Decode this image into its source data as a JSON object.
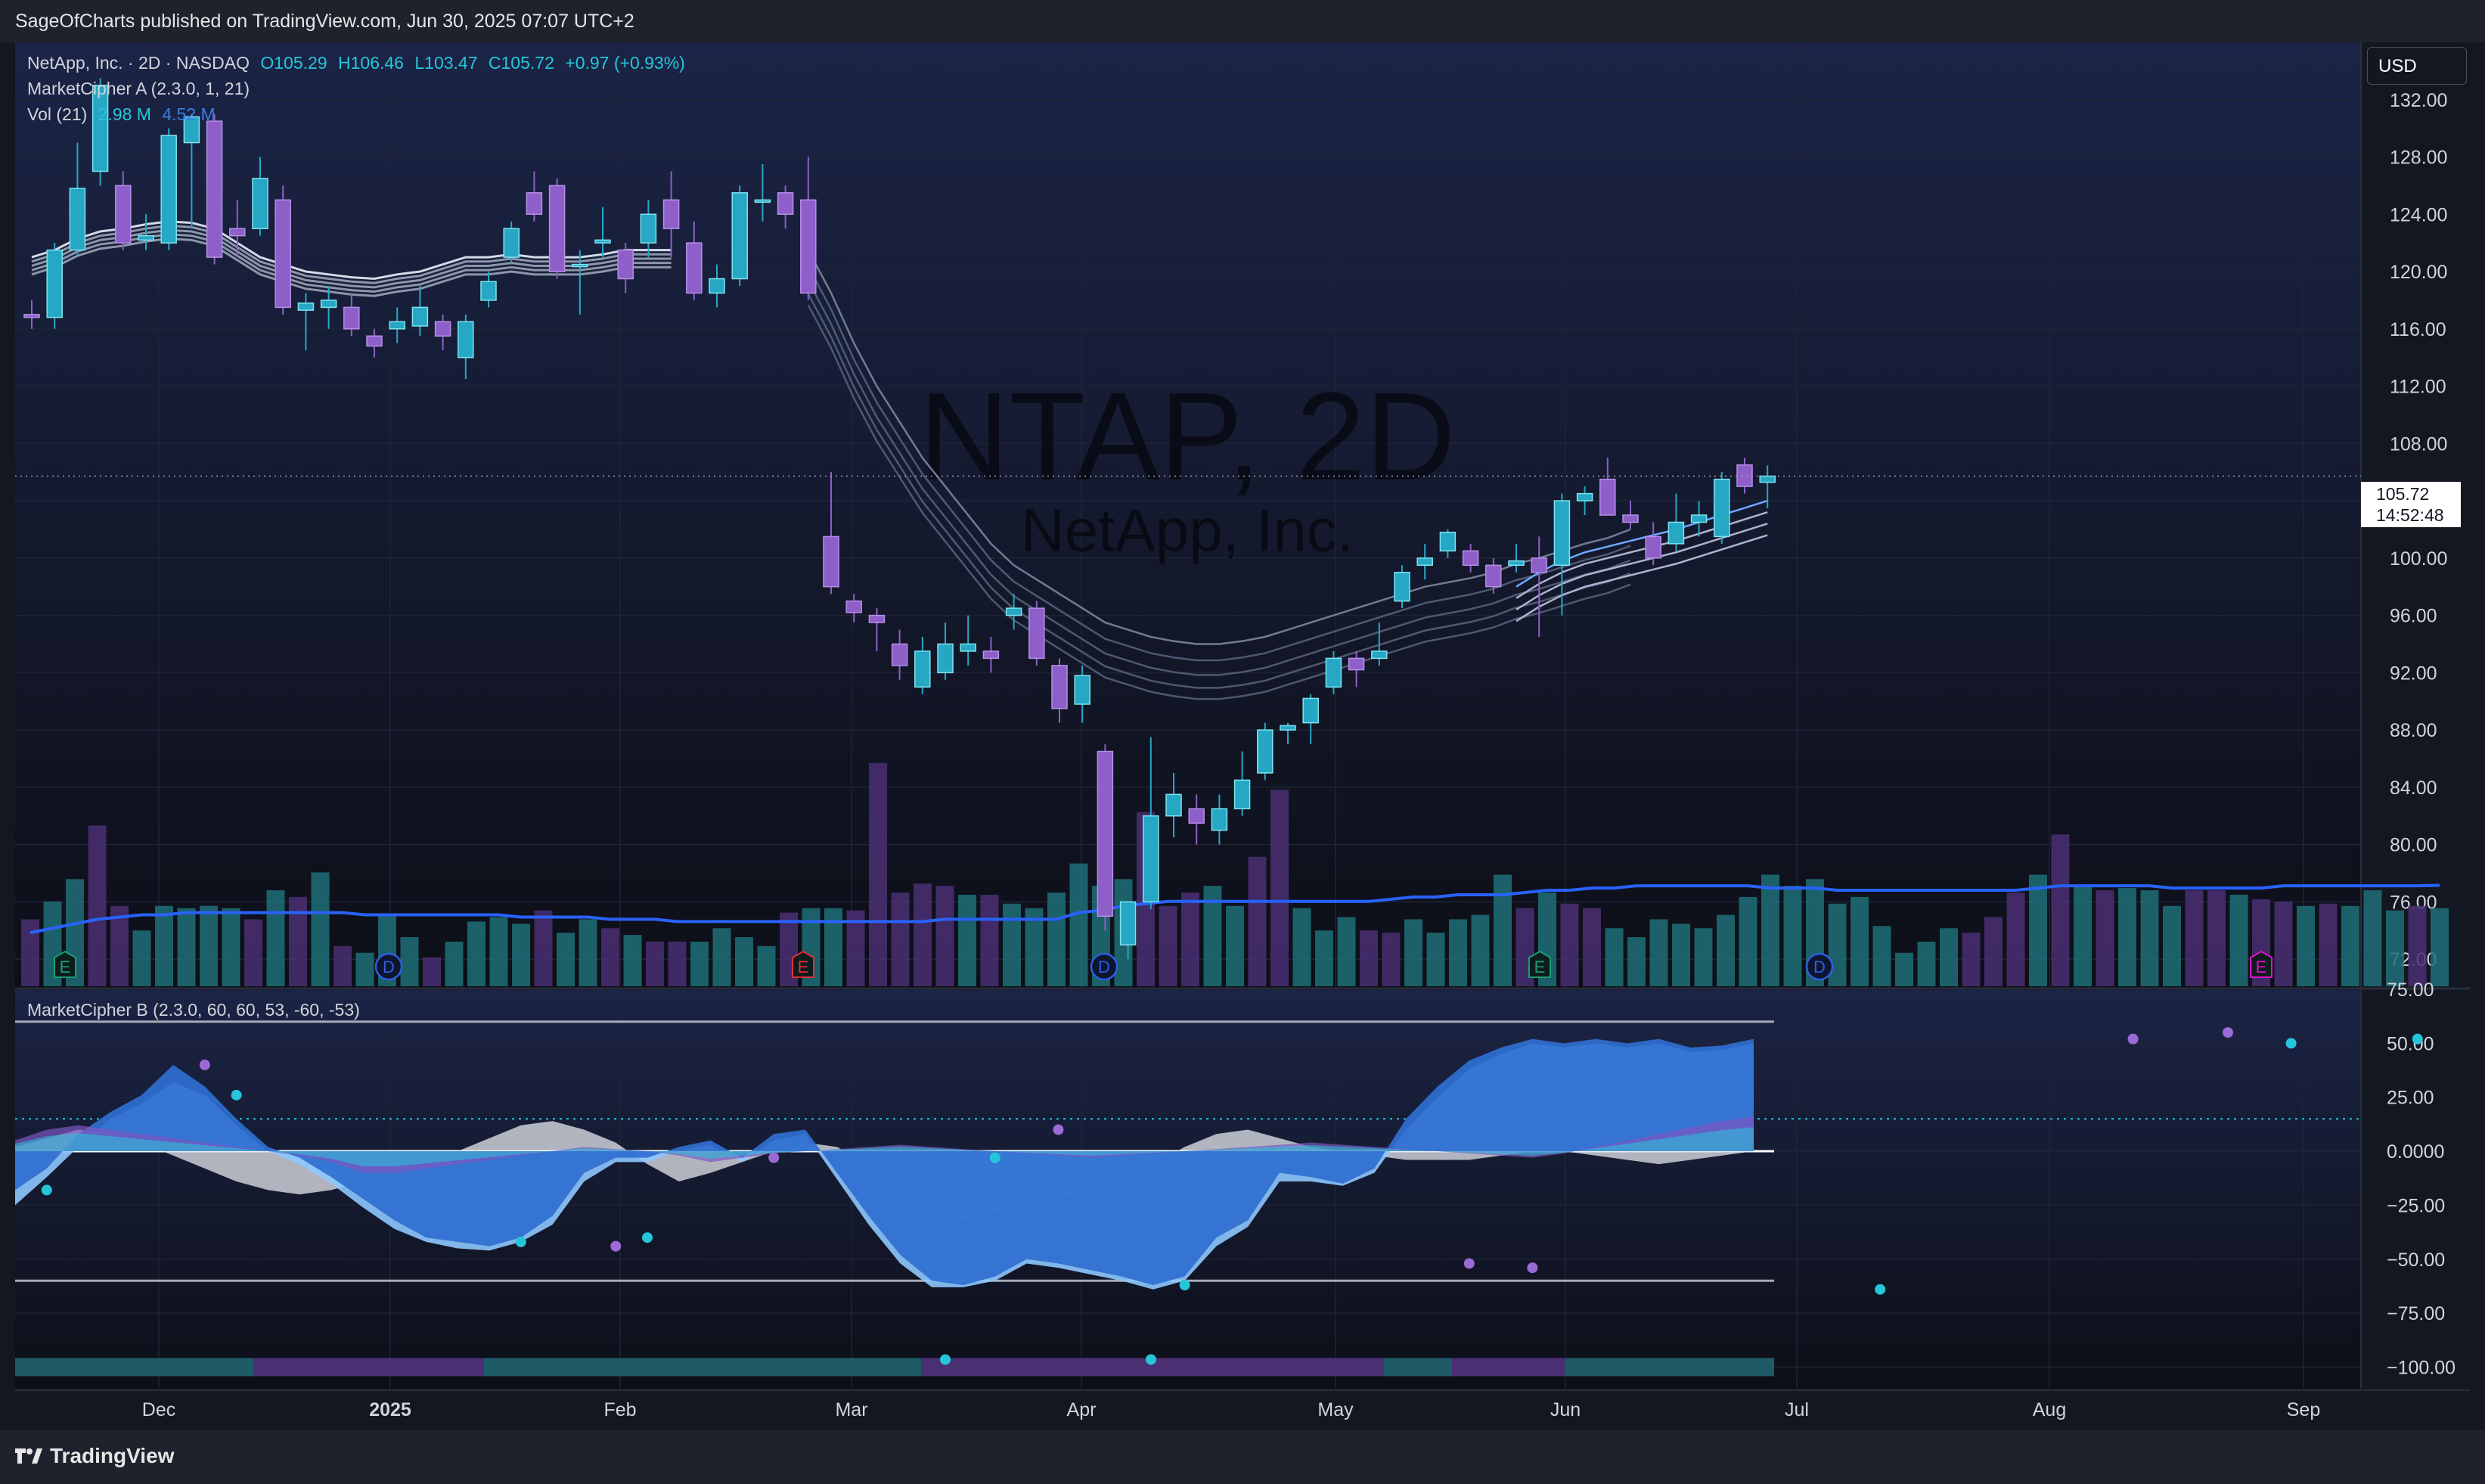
{
  "header": {
    "published_by": "SageOfCharts published on TradingView.com, Jun 30, 2025 07:07 UTC+2"
  },
  "legend": {
    "symbol": "NetApp, Inc. · 2D · NASDAQ",
    "open": "O105.29",
    "high": "H106.46",
    "low": "L103.47",
    "close": "C105.72",
    "change": "+0.97 (+0.93%)",
    "indicator_a": "MarketCipher A (2.3.0, 1, 21)",
    "vol_label": "Vol (21)",
    "vol_value": "2.98 M",
    "vol_ma": "4.52 M",
    "indicator_b": "MarketCipher B (2.3.0, 60, 60, 53, -60, -53)"
  },
  "currency": "USD",
  "last_price": {
    "price": "105.72",
    "countdown": "14:52:48"
  },
  "watermark": {
    "ticker": "NTAP, 2D",
    "company": "NetApp, Inc."
  },
  "footer": {
    "brand": "TradingView"
  },
  "colors": {
    "up": "#26a7c4",
    "down": "#8e5fc9",
    "background": "#131722",
    "ma_line": "#2962ff",
    "wave_blue": "#2f6fd0",
    "wave_light": "#8ec8ff"
  },
  "chart_data": [
    {
      "type": "candlestick",
      "title": "NetApp, Inc. · 2D · NASDAQ",
      "ylim": [
        70,
        136
      ],
      "y_ticks": [
        "132.00",
        "128.00",
        "124.00",
        "120.00",
        "116.00",
        "112.00",
        "108.00",
        "104.00",
        "100.00",
        "96.00",
        "92.00",
        "88.00",
        "84.00",
        "80.00",
        "76.00",
        "72.00"
      ],
      "x_ticks": [
        "Dec",
        "2025",
        "Feb",
        "Mar",
        "Apr",
        "May",
        "Jun",
        "Jul",
        "Aug",
        "Sep"
      ],
      "candles": [
        {
          "o": 117.0,
          "h": 118.0,
          "l": 116.0,
          "c": 116.8
        },
        {
          "o": 116.8,
          "h": 122.0,
          "l": 116.0,
          "c": 121.5
        },
        {
          "o": 121.5,
          "h": 129.0,
          "l": 121.0,
          "c": 125.8
        },
        {
          "o": 127.0,
          "h": 133.5,
          "l": 126.0,
          "c": 133.0
        },
        {
          "o": 126.0,
          "h": 127.0,
          "l": 121.5,
          "c": 122.0
        },
        {
          "o": 122.2,
          "h": 124.0,
          "l": 121.5,
          "c": 122.5
        },
        {
          "o": 122.0,
          "h": 130.0,
          "l": 121.5,
          "c": 129.5
        },
        {
          "o": 129.0,
          "h": 131.0,
          "l": 123.0,
          "c": 130.8
        },
        {
          "o": 130.5,
          "h": 131.0,
          "l": 120.5,
          "c": 121.0
        },
        {
          "o": 123.0,
          "h": 125.0,
          "l": 121.0,
          "c": 122.5
        },
        {
          "o": 123.0,
          "h": 128.0,
          "l": 122.5,
          "c": 126.5
        },
        {
          "o": 125.0,
          "h": 126.0,
          "l": 117.0,
          "c": 117.5
        },
        {
          "o": 117.3,
          "h": 118.5,
          "l": 114.5,
          "c": 117.8
        },
        {
          "o": 117.5,
          "h": 119.0,
          "l": 116.0,
          "c": 118.0
        },
        {
          "o": 117.5,
          "h": 118.5,
          "l": 115.5,
          "c": 116.0
        },
        {
          "o": 115.5,
          "h": 116.0,
          "l": 114.0,
          "c": 114.8
        },
        {
          "o": 116.0,
          "h": 117.5,
          "l": 115.0,
          "c": 116.5
        },
        {
          "o": 116.2,
          "h": 119.0,
          "l": 115.5,
          "c": 117.5
        },
        {
          "o": 116.5,
          "h": 117.0,
          "l": 114.5,
          "c": 115.5
        },
        {
          "o": 114.0,
          "h": 117.0,
          "l": 112.5,
          "c": 116.5
        },
        {
          "o": 118.0,
          "h": 120.0,
          "l": 117.5,
          "c": 119.3
        },
        {
          "o": 121.0,
          "h": 123.5,
          "l": 120.5,
          "c": 123.0
        },
        {
          "o": 125.5,
          "h": 127.0,
          "l": 123.5,
          "c": 124.0
        },
        {
          "o": 126.0,
          "h": 126.5,
          "l": 119.5,
          "c": 120.0
        },
        {
          "o": 120.5,
          "h": 121.5,
          "l": 117.0,
          "c": 120.5
        },
        {
          "o": 122.0,
          "h": 124.5,
          "l": 121.0,
          "c": 122.2
        },
        {
          "o": 121.5,
          "h": 122.0,
          "l": 118.5,
          "c": 119.5
        },
        {
          "o": 122.0,
          "h": 125.0,
          "l": 121.0,
          "c": 124.0
        },
        {
          "o": 125.0,
          "h": 127.0,
          "l": 121.0,
          "c": 123.0
        },
        {
          "o": 122.0,
          "h": 123.5,
          "l": 118.0,
          "c": 118.5
        },
        {
          "o": 118.5,
          "h": 120.5,
          "l": 117.5,
          "c": 119.5
        },
        {
          "o": 119.5,
          "h": 126.0,
          "l": 119.0,
          "c": 125.5
        },
        {
          "o": 125.0,
          "h": 127.5,
          "l": 123.5,
          "c": 125.0
        },
        {
          "o": 125.5,
          "h": 126.0,
          "l": 123.0,
          "c": 124.0
        },
        {
          "o": 125.0,
          "h": 128.0,
          "l": 118.0,
          "c": 118.5
        },
        {
          "o": 101.5,
          "h": 106.0,
          "l": 97.5,
          "c": 98.0
        },
        {
          "o": 97.0,
          "h": 97.5,
          "l": 95.5,
          "c": 96.2
        },
        {
          "o": 96.0,
          "h": 96.5,
          "l": 93.5,
          "c": 95.5
        },
        {
          "o": 94.0,
          "h": 95.0,
          "l": 91.5,
          "c": 92.5
        },
        {
          "o": 91.0,
          "h": 94.5,
          "l": 90.5,
          "c": 93.5
        },
        {
          "o": 92.0,
          "h": 95.5,
          "l": 91.5,
          "c": 94.0
        },
        {
          "o": 93.5,
          "h": 96.0,
          "l": 92.5,
          "c": 94.0
        },
        {
          "o": 93.5,
          "h": 94.5,
          "l": 92.0,
          "c": 93.0
        },
        {
          "o": 96.0,
          "h": 97.5,
          "l": 95.0,
          "c": 96.5
        },
        {
          "o": 96.5,
          "h": 97.0,
          "l": 92.5,
          "c": 93.0
        },
        {
          "o": 92.5,
          "h": 93.0,
          "l": 88.5,
          "c": 89.5
        },
        {
          "o": 89.8,
          "h": 92.5,
          "l": 88.5,
          "c": 91.8
        },
        {
          "o": 86.5,
          "h": 87.0,
          "l": 74.0,
          "c": 75.0
        },
        {
          "o": 73.0,
          "h": 76.0,
          "l": 72.0,
          "c": 76.0
        },
        {
          "o": 76.0,
          "h": 87.5,
          "l": 75.5,
          "c": 82.0
        },
        {
          "o": 82.0,
          "h": 85.0,
          "l": 80.5,
          "c": 83.5
        },
        {
          "o": 82.5,
          "h": 83.5,
          "l": 80.0,
          "c": 81.5
        },
        {
          "o": 81.0,
          "h": 83.5,
          "l": 80.0,
          "c": 82.5
        },
        {
          "o": 82.5,
          "h": 86.5,
          "l": 82.0,
          "c": 84.5
        },
        {
          "o": 85.0,
          "h": 88.5,
          "l": 84.5,
          "c": 88.0
        },
        {
          "o": 88.0,
          "h": 88.5,
          "l": 87.0,
          "c": 88.3
        },
        {
          "o": 88.5,
          "h": 90.5,
          "l": 87.0,
          "c": 90.2
        },
        {
          "o": 91.0,
          "h": 93.5,
          "l": 90.5,
          "c": 93.0
        },
        {
          "o": 93.0,
          "h": 93.5,
          "l": 91.0,
          "c": 92.2
        },
        {
          "o": 93.0,
          "h": 95.5,
          "l": 92.5,
          "c": 93.5
        },
        {
          "o": 97.0,
          "h": 99.5,
          "l": 96.5,
          "c": 99.0
        },
        {
          "o": 99.5,
          "h": 101.0,
          "l": 98.5,
          "c": 100.0
        },
        {
          "o": 100.5,
          "h": 102.0,
          "l": 100.0,
          "c": 101.8
        },
        {
          "o": 100.5,
          "h": 101.0,
          "l": 99.0,
          "c": 99.5
        },
        {
          "o": 99.5,
          "h": 100.0,
          "l": 97.5,
          "c": 98.0
        },
        {
          "o": 99.5,
          "h": 101.0,
          "l": 99.0,
          "c": 99.8
        },
        {
          "o": 100.0,
          "h": 101.5,
          "l": 94.5,
          "c": 99.0
        },
        {
          "o": 99.5,
          "h": 104.5,
          "l": 96.0,
          "c": 104.0
        },
        {
          "o": 104.0,
          "h": 105.0,
          "l": 103.0,
          "c": 104.5
        },
        {
          "o": 105.5,
          "h": 107.0,
          "l": 103.0,
          "c": 103.0
        },
        {
          "o": 103.0,
          "h": 104.0,
          "l": 102.0,
          "c": 102.5
        },
        {
          "o": 101.5,
          "h": 102.5,
          "l": 99.5,
          "c": 100.0
        },
        {
          "o": 101.0,
          "h": 104.5,
          "l": 100.5,
          "c": 102.5
        },
        {
          "o": 102.5,
          "h": 104.0,
          "l": 101.5,
          "c": 103.0
        },
        {
          "o": 101.5,
          "h": 106.0,
          "l": 101.0,
          "c": 105.5
        },
        {
          "o": 106.5,
          "h": 107.0,
          "l": 104.5,
          "c": 105.0
        },
        {
          "o": 105.29,
          "h": 106.46,
          "l": 103.47,
          "c": 105.72
        }
      ],
      "ribbon_segments": [
        [
          121.0,
          121.5,
          122.3,
          122.8,
          123.0,
          123.3,
          123.5,
          123.4,
          123.0,
          122.0,
          121.0,
          120.5,
          120.0,
          119.8,
          119.6,
          119.5,
          119.8,
          120.0,
          120.5,
          121.0,
          121.0,
          121.2,
          121.0,
          121.0,
          121.0,
          121.2,
          121.5,
          121.5,
          121.5
        ],
        [
          121.5,
          118.5,
          115.0,
          112.0,
          109.5,
          107.0,
          105.0,
          103.0,
          101.0,
          99.5,
          98.5,
          97.5,
          96.5,
          95.5,
          95.0,
          94.5,
          94.2,
          94.0,
          94.0,
          94.2,
          94.5,
          95.0,
          95.5,
          96.0,
          96.5,
          97.0,
          97.5,
          98.0,
          98.3,
          98.6,
          99.0,
          99.6,
          100.0,
          100.5,
          101.0,
          101.4,
          102.0
        ]
      ],
      "ribbon_offsets": [
        0,
        -1.2,
        -2.4,
        -3.6,
        -4.8
      ]
    },
    {
      "type": "bar",
      "title": "Vol (21)",
      "values": [
        3.0,
        3.8,
        4.8,
        7.2,
        3.6,
        2.5,
        3.6,
        3.5,
        3.6,
        3.5,
        3.0,
        4.3,
        4.0,
        5.1,
        1.8,
        1.5,
        3.2,
        2.2,
        1.3,
        2.0,
        2.9,
        3.1,
        2.8,
        3.4,
        2.4,
        3.0,
        2.6,
        2.3,
        2.0,
        2.0,
        2.0,
        2.6,
        2.2,
        1.8,
        3.3,
        3.5,
        3.5,
        3.4,
        10.0,
        4.2,
        4.6,
        4.5,
        4.1,
        4.1,
        3.7,
        3.5,
        4.2,
        5.5,
        4.5,
        4.8,
        7.8,
        3.6,
        4.2,
        4.5,
        3.6,
        5.8,
        8.8,
        3.5,
        2.5,
        3.1,
        2.5,
        2.4,
        3.0,
        2.4,
        3.0,
        3.2,
        5.0,
        3.5,
        4.2,
        3.7,
        3.5,
        2.6,
        2.2,
        3.0,
        2.8,
        2.6,
        3.2,
        4.0,
        5.0,
        4.5,
        4.8,
        3.7,
        4.0,
        2.7,
        1.5,
        2.0,
        2.6,
        2.4,
        3.1,
        4.2,
        5.0,
        6.8,
        4.5,
        4.3,
        4.4,
        4.3,
        3.6,
        4.3,
        4.3,
        4.1,
        3.9,
        3.8,
        3.6,
        3.7,
        3.6,
        4.3,
        3.4,
        3.6,
        3.5
      ],
      "directions": [
        "d",
        "u",
        "u",
        "d",
        "d",
        "u",
        "u",
        "u",
        "u",
        "u",
        "d",
        "u",
        "d",
        "u",
        "d",
        "u",
        "u",
        "u",
        "d",
        "u",
        "u",
        "u",
        "u",
        "d",
        "u",
        "u",
        "d",
        "u",
        "d",
        "d",
        "u",
        "u",
        "u",
        "u",
        "d",
        "u",
        "u",
        "d",
        "d",
        "d",
        "d",
        "d",
        "u",
        "d",
        "u",
        "u",
        "u",
        "u",
        "u",
        "u",
        "d",
        "d",
        "d",
        "u",
        "u",
        "d",
        "d",
        "u",
        "u",
        "u",
        "d",
        "d",
        "u",
        "u",
        "u",
        "u",
        "u",
        "d",
        "u",
        "d",
        "d",
        "u",
        "u",
        "u",
        "u",
        "u",
        "u",
        "u",
        "u",
        "u",
        "u",
        "u",
        "u",
        "u",
        "u",
        "u",
        "u",
        "d",
        "d",
        "d",
        "u",
        "d",
        "u",
        "d",
        "u",
        "u",
        "u",
        "d",
        "d",
        "u",
        "d",
        "d",
        "u",
        "d",
        "u",
        "u",
        "u",
        "d",
        "u",
        "d",
        "u"
      ],
      "ma_values": [
        2.4,
        2.6,
        2.8,
        3.0,
        3.1,
        3.2,
        3.2,
        3.3,
        3.3,
        3.3,
        3.3,
        3.3,
        3.3,
        3.3,
        3.3,
        3.2,
        3.2,
        3.2,
        3.2,
        3.2,
        3.2,
        3.2,
        3.1,
        3.1,
        3.1,
        3.1,
        3.0,
        3.0,
        3.0,
        2.9,
        2.9,
        2.9,
        2.9,
        2.9,
        2.9,
        2.9,
        2.9,
        2.9,
        2.9,
        2.9,
        2.9,
        3.0,
        3.0,
        3.0,
        3.0,
        3.0,
        3.0,
        3.3,
        3.4,
        3.6,
        3.7,
        3.8,
        3.8,
        3.8,
        3.8,
        3.8,
        3.8,
        3.8,
        3.8,
        3.8,
        3.8,
        3.9,
        4.0,
        4.0,
        4.1,
        4.1,
        4.1,
        4.2,
        4.3,
        4.3,
        4.4,
        4.4,
        4.5,
        4.5,
        4.5,
        4.5,
        4.5,
        4.5,
        4.4,
        4.4,
        4.4,
        4.3,
        4.3,
        4.3,
        4.3,
        4.3,
        4.3,
        4.3,
        4.3,
        4.3,
        4.4,
        4.5,
        4.5,
        4.5,
        4.5,
        4.5,
        4.4,
        4.4,
        4.4,
        4.4,
        4.4,
        4.5,
        4.5,
        4.5,
        4.5,
        4.5,
        4.5,
        4.5,
        4.52
      ]
    },
    {
      "type": "area",
      "title": "MarketCipher B (2.3.0, 60, 60, 53, -60, -53)",
      "ylim": [
        -110,
        75
      ],
      "y_ticks": [
        "75.00",
        "50.00",
        "25.00",
        "0.0000",
        "−25.00",
        "−50.00",
        "−75.00",
        "−100.00"
      ],
      "overbought": 60,
      "oversold": -60,
      "dotted_level": 15,
      "wave1": [
        -18,
        -8,
        8,
        18,
        26,
        40,
        30,
        15,
        2,
        -3,
        -12,
        -22,
        -32,
        -40,
        -42,
        -44,
        -40,
        -30,
        -10,
        -3,
        -3,
        2,
        5,
        -3,
        8,
        10,
        -10,
        -30,
        -48,
        -60,
        -62,
        -58,
        -50,
        -52,
        -55,
        -58,
        -62,
        -58,
        -40,
        -32,
        -10,
        -12,
        -15,
        -8,
        15,
        30,
        42,
        48,
        52,
        50,
        52,
        50,
        52,
        48,
        49,
        52
      ],
      "wave2": [
        -25,
        -12,
        2,
        15,
        22,
        32,
        26,
        12,
        0,
        -6,
        -15,
        -26,
        -36,
        -42,
        -45,
        -46,
        -42,
        -34,
        -14,
        -5,
        -5,
        0,
        3,
        -5,
        5,
        8,
        -13,
        -34,
        -52,
        -63,
        -63,
        -60,
        -52,
        -54,
        -57,
        -60,
        -64,
        -60,
        -44,
        -35,
        -14,
        -14,
        -16,
        -10,
        10,
        25,
        38,
        45,
        50,
        48,
        50,
        48,
        50,
        46,
        47,
        50
      ],
      "money_flow": [
        5,
        10,
        12,
        10,
        8,
        6,
        4,
        2,
        0,
        -2,
        -5,
        -10,
        -10,
        -8,
        -6,
        -4,
        -2,
        0,
        2,
        1,
        0,
        -2,
        -5,
        -3,
        -1,
        0,
        1,
        2,
        3,
        2,
        1,
        0,
        -1,
        -2,
        -3,
        -2,
        -1,
        0,
        1,
        2,
        3,
        4,
        3,
        2,
        1,
        0,
        -1,
        -2,
        -3,
        -1,
        2,
        5,
        8,
        11,
        14,
        16
      ],
      "vwap": [
        2,
        6,
        10,
        8,
        4,
        -2,
        -8,
        -14,
        -18,
        -20,
        -18,
        -14,
        -8,
        -4,
        0,
        6,
        12,
        14,
        10,
        4,
        -6,
        -14,
        -10,
        -5,
        0,
        4,
        2,
        -6,
        -20,
        -30,
        -32,
        -28,
        -26,
        -22,
        -18,
        -12,
        -6,
        2,
        8,
        10,
        6,
        2,
        0,
        -2,
        -4,
        -4,
        -4,
        -2,
        0,
        0,
        -2,
        -4,
        -6,
        -4,
        -2,
        0
      ],
      "buy_dots": [
        [
          1,
          -18
        ],
        [
          7,
          26
        ],
        [
          16,
          -42
        ],
        [
          20,
          -40
        ],
        [
          31,
          -3
        ],
        [
          37,
          -62
        ],
        [
          59,
          -64
        ],
        [
          72,
          50
        ],
        [
          76,
          52
        ]
      ],
      "sell_dots": [
        [
          6,
          40
        ],
        [
          19,
          -44
        ],
        [
          24,
          -3
        ],
        [
          33,
          10
        ],
        [
          46,
          -52
        ],
        [
          48,
          -54
        ],
        [
          67,
          52
        ],
        [
          70,
          55
        ]
      ],
      "bottom_strip": [
        "u",
        "d",
        "u",
        "d",
        "u",
        "d",
        "u"
      ]
    }
  ],
  "event_markers": [
    "E",
    "D",
    "E",
    "D",
    "E",
    "D",
    "E"
  ]
}
